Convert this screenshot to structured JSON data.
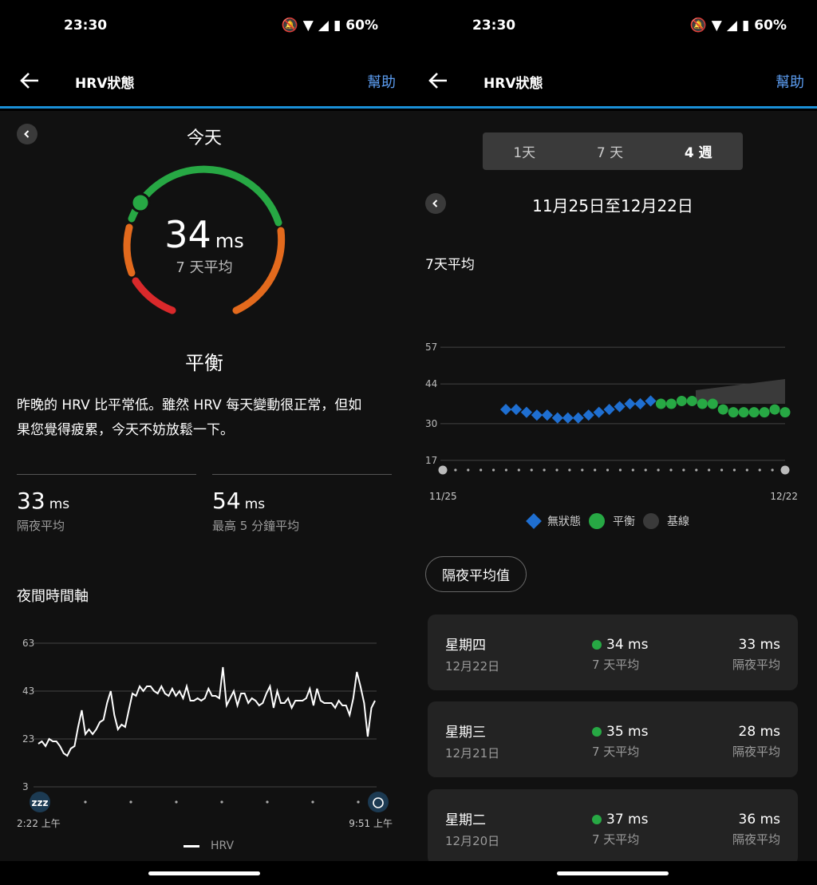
{
  "status": {
    "time": "23:30",
    "battery": "60%"
  },
  "appbar": {
    "title": "HRV狀態",
    "help": "幫助"
  },
  "left": {
    "day_label": "今天",
    "gauge": {
      "value": "34",
      "unit": "ms",
      "sub": "7 天平均"
    },
    "status_label": "平衡",
    "description_line1": "昨晚的 HRV 比平常低。雖然 HRV 每天變動很正常，但如",
    "description_line2": "果您覺得疲累，今天不妨放鬆一下。",
    "stats": [
      {
        "value": "33",
        "unit": "ms",
        "label": "隔夜平均"
      },
      {
        "value": "54",
        "unit": "ms",
        "label": "最高 5 分鐘平均"
      }
    ],
    "timeline_title": "夜間時間軸",
    "timeline_legend": "HRV",
    "timeline_start": "2:22 上午",
    "timeline_end": "9:51 上午"
  },
  "right": {
    "tabs": [
      "1天",
      "7 天",
      "4 週"
    ],
    "selected_tab": "4 週",
    "date_range": "11月25日至12月22日",
    "section_title": "7天平均",
    "x_start": "11/25",
    "x_end": "12/22",
    "legend": [
      "無狀態",
      "平衡",
      "基線"
    ],
    "chip": "隔夜平均值",
    "days": [
      {
        "weekday": "星期四",
        "date": "12月22日",
        "avg_value": "34 ms",
        "avg_label": "7 天平均",
        "night_value": "33 ms",
        "night_label": "隔夜平均"
      },
      {
        "weekday": "星期三",
        "date": "12月21日",
        "avg_value": "35 ms",
        "avg_label": "7 天平均",
        "night_value": "28 ms",
        "night_label": "隔夜平均"
      },
      {
        "weekday": "星期二",
        "date": "12月20日",
        "avg_value": "37 ms",
        "avg_label": "7 天平均",
        "night_value": "36 ms",
        "night_label": "隔夜平均"
      }
    ]
  },
  "chart_data": [
    {
      "type": "line",
      "ylim": [
        3,
        63
      ],
      "yticks": [
        63,
        43,
        23,
        3
      ],
      "series": [
        {
          "name": "HRV",
          "values": [
            21,
            22,
            20,
            23,
            22,
            22,
            20,
            17,
            16,
            19,
            20,
            28,
            35,
            25,
            27,
            25,
            27,
            30,
            31,
            38,
            43,
            33,
            27,
            29,
            28,
            35,
            42,
            41,
            45,
            43,
            45,
            45,
            43,
            42,
            45,
            42,
            41,
            44,
            41,
            43,
            40,
            45,
            39,
            39,
            40,
            39,
            40,
            44,
            41,
            41,
            40,
            53,
            37,
            40,
            43,
            37,
            42,
            42,
            38,
            40,
            39,
            37,
            38,
            42,
            45,
            36,
            43,
            38,
            38,
            40,
            36,
            39,
            39,
            39,
            40,
            44,
            37,
            44,
            39,
            38,
            38,
            38,
            36,
            39,
            37,
            37,
            33,
            40,
            51,
            45,
            38,
            24,
            36,
            39
          ]
        }
      ]
    },
    {
      "type": "scatter",
      "ylim": [
        4,
        70
      ],
      "yticks": [
        57,
        44,
        30,
        17
      ],
      "x": [
        "11/25",
        "11/26",
        "11/27",
        "11/28",
        "11/29",
        "11/30",
        "12/1",
        "12/2",
        "12/3",
        "12/4",
        "12/5",
        "12/6",
        "12/7",
        "12/8",
        "12/9",
        "12/10",
        "12/11",
        "12/12",
        "12/13",
        "12/14",
        "12/15",
        "12/16",
        "12/17",
        "12/18",
        "12/19",
        "12/20",
        "12/21",
        "12/22"
      ],
      "series": [
        {
          "name": "無狀態",
          "values": [
            35,
            35,
            34,
            33,
            33,
            32,
            32,
            32,
            33,
            34,
            35,
            36,
            37,
            37,
            38,
            null,
            null,
            null,
            null,
            null,
            null,
            null,
            null,
            null,
            null,
            null,
            null,
            null
          ]
        },
        {
          "name": "平衡",
          "values": [
            null,
            null,
            null,
            null,
            null,
            null,
            null,
            null,
            null,
            null,
            null,
            null,
            null,
            null,
            null,
            37,
            37,
            38,
            38,
            37,
            37,
            35,
            34,
            34,
            34,
            34,
            35,
            34
          ]
        }
      ]
    }
  ]
}
